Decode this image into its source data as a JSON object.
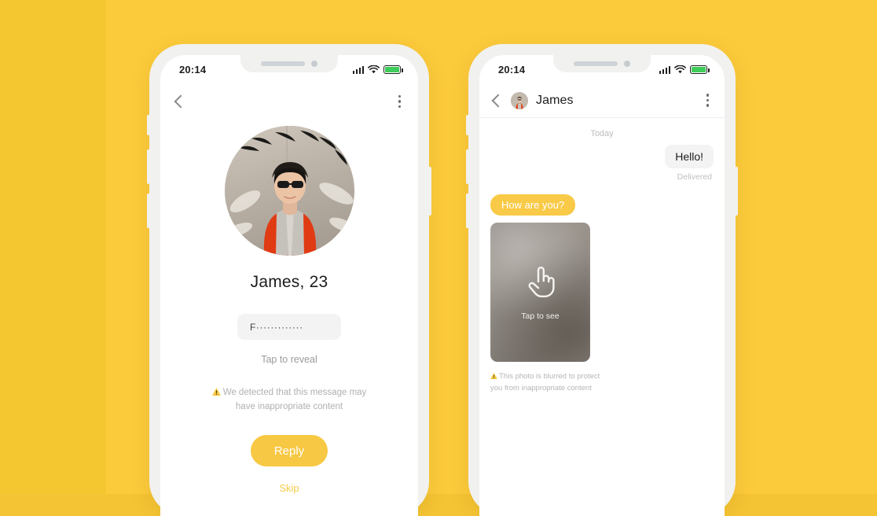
{
  "theme": {
    "background": "#FCCB3B",
    "background_band": "#F4C62F",
    "accent": "#F7C843",
    "bubble_incoming": "#F8CA47",
    "bubble_outgoing": "#F3F3F3",
    "warning_text": "#B0B0B0",
    "battery_green": "#3ECD5A"
  },
  "status_bar": {
    "time": "20:14",
    "signal_icon": "signal-bars-icon",
    "wifi_icon": "wifi-icon",
    "battery_icon": "battery-icon"
  },
  "left_phone": {
    "nav": {
      "back_icon": "chevron-left-icon",
      "menu_icon": "more-vertical-icon"
    },
    "profile": {
      "avatar_alt": "james-profile-photo",
      "name_age": "James, 23"
    },
    "masked_message": {
      "value": "F·············",
      "hint": "Tap to reveal"
    },
    "warning": {
      "icon": "warning-triangle-icon",
      "line1": "We detected that this message may",
      "line2": "have inappropriate content"
    },
    "actions": {
      "primary_label": "Reply",
      "secondary_label": "Skip"
    }
  },
  "right_phone": {
    "header": {
      "back_icon": "chevron-left-icon",
      "avatar_alt": "james-avatar-thumb",
      "title": "James",
      "menu_icon": "more-vertical-icon"
    },
    "date_divider": "Today",
    "messages": [
      {
        "id": "m1",
        "direction": "outgoing",
        "text": "Hello!",
        "status": "Delivered"
      },
      {
        "id": "m2",
        "direction": "incoming",
        "text": "How are you?"
      },
      {
        "id": "m3",
        "direction": "incoming",
        "type": "blurred-photo",
        "overlay_icon": "tap-hand-icon",
        "overlay_label": "Tap to see"
      }
    ],
    "warning": {
      "icon": "warning-triangle-icon",
      "line1": "This photo is blurred to protect",
      "line2": "you from inappropriate content"
    }
  }
}
